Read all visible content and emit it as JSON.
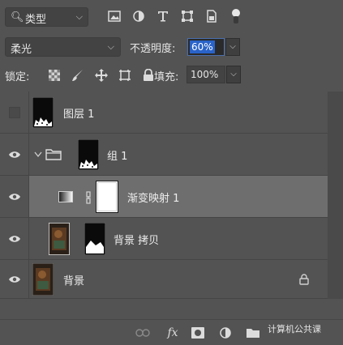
{
  "filter": {
    "kind_label": "类型",
    "icons": [
      "image-filter-icon",
      "adjustment-filter-icon",
      "type-filter-icon",
      "shape-filter-icon",
      "smart-object-filter-icon",
      "filter-toggle-icon"
    ]
  },
  "blend": {
    "mode": "柔光",
    "opacity_label": "不透明度:",
    "opacity_value": "60%"
  },
  "lock": {
    "label": "锁定:",
    "icons": [
      "lock-transparent-pixels-icon",
      "lock-image-pixels-icon",
      "lock-position-icon",
      "lock-artboard-icon",
      "lock-all-icon"
    ],
    "fill_label": "填充:",
    "fill_value": "100%"
  },
  "layers": [
    {
      "name": "图层 1",
      "visible": false
    },
    {
      "name": "组 1",
      "visible": true,
      "group": true
    },
    {
      "name": "渐变映射 1",
      "visible": true,
      "selected": true
    },
    {
      "name": "背景 拷贝",
      "visible": true
    },
    {
      "name": "背景",
      "visible": true,
      "locked": true
    }
  ],
  "toolbar": {
    "fx_label": "fx",
    "icons": [
      "link-layers-icon",
      "fx-icon",
      "add-mask-icon",
      "new-adjustment-icon",
      "new-group-icon",
      "new-layer-icon",
      "delete-layer-icon"
    ]
  },
  "watermark": "计算机公共课",
  "colors": {
    "panel_bg": "#535353",
    "selected_row": "#6e6e6e",
    "accent_selection": "#2a63c8"
  }
}
